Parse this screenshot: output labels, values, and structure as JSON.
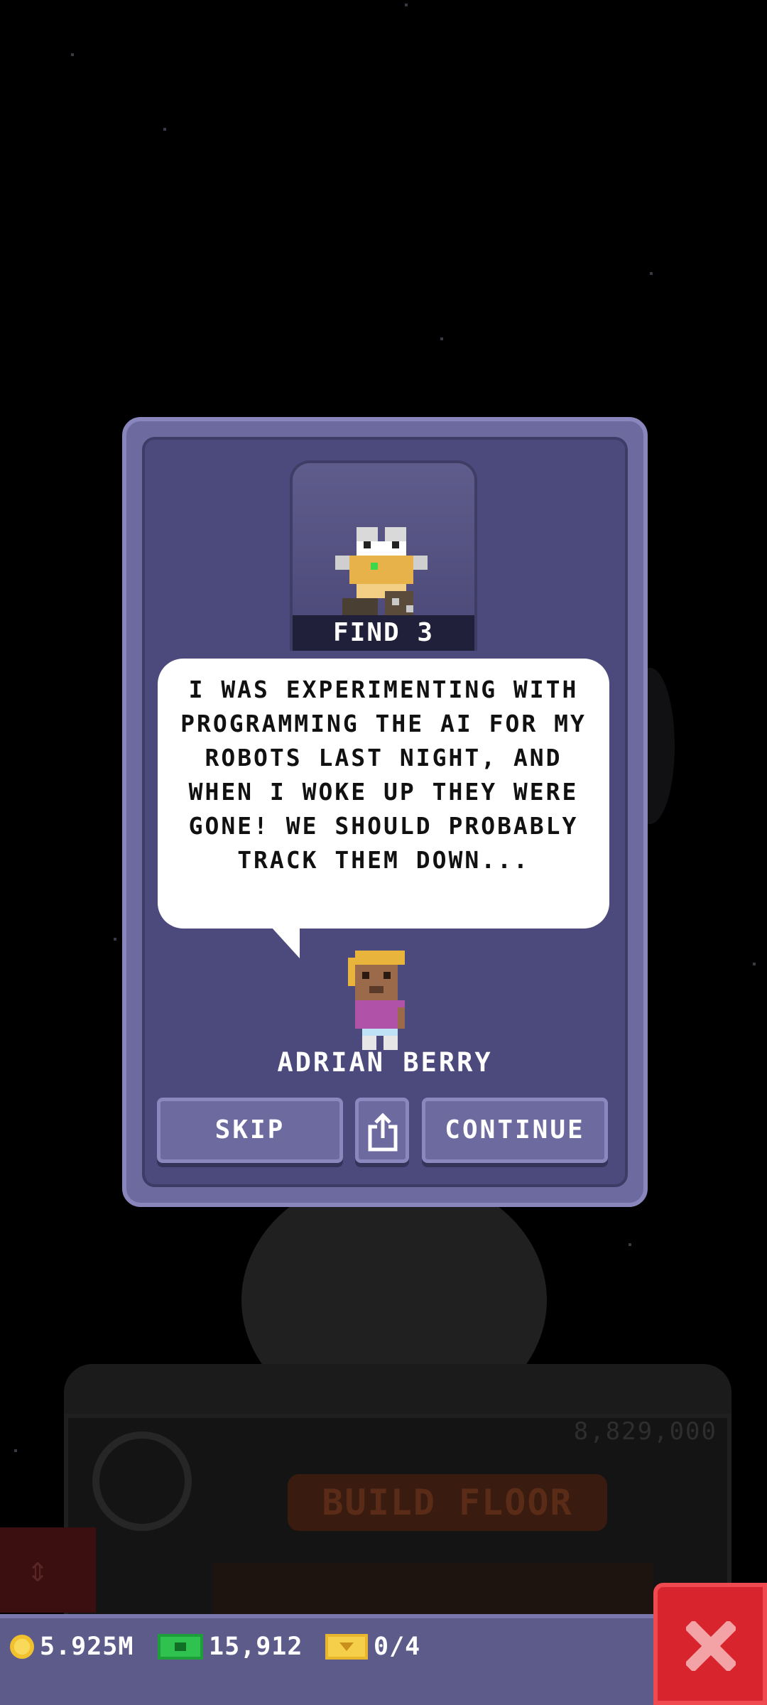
{
  "dialog": {
    "badge_label": "FIND 3",
    "badge_icon": "robot-icon",
    "message": "I WAS EXPERIMENTING WITH PROGRAMMING THE AI FOR MY ROBOTS LAST NIGHT, AND WHEN I WOKE UP THEY WERE GONE! WE SHOULD PROBABLY TRACK THEM DOWN...",
    "character_name": "ADRIAN BERRY",
    "skip_label": "SKIP",
    "share_icon": "share-icon",
    "continue_label": "CONTINUE"
  },
  "background": {
    "floor_price": "8,829,000",
    "build_floor_label": "BUILD FLOOR"
  },
  "status_bar": {
    "coins": "5.925M",
    "bux": "15,912",
    "tickets": "0/4",
    "close_icon": "close-icon"
  },
  "colors": {
    "modal_bg": "#4c4a7c",
    "modal_border": "#6d6aa0",
    "close_red": "#d8242c",
    "bar_bg": "#5d5b8a"
  }
}
